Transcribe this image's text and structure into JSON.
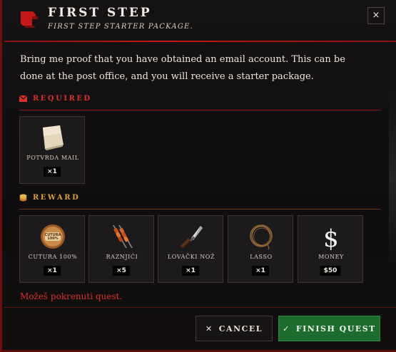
{
  "header": {
    "title": "FIRST STEP",
    "subtitle": "FIRST STEP STARTER PACKAGE.",
    "close_label": "×"
  },
  "description": "Bring me proof that you have obtained an email account. This can be done at the post office, and you will receive a starter package.",
  "required": {
    "heading": "REQUIRED",
    "items": [
      {
        "label": "POTVRDA MAIL",
        "qty": "×1",
        "icon": "paper-note-icon"
      }
    ]
  },
  "reward": {
    "heading": "REWARD",
    "items": [
      {
        "label": "CUTURA 100%",
        "qty": "×1",
        "icon": "burger-badge-icon"
      },
      {
        "label": "RAZNJIĆI",
        "qty": "×5",
        "icon": "skewers-icon"
      },
      {
        "label": "LOVAČKI NOŽ",
        "qty": "×1",
        "icon": "hunting-knife-icon"
      },
      {
        "label": "LASSO",
        "qty": "×1",
        "icon": "lasso-icon"
      },
      {
        "label": "MONEY",
        "qty": "$50",
        "icon": "dollar-icon"
      }
    ]
  },
  "status": "Možeš pokrenuti quest.",
  "buttons": {
    "cancel": "CANCEL",
    "finish": "FINISH QUEST"
  },
  "colors": {
    "accent_red": "#d8322a",
    "reward_gold": "#d9a040",
    "finish_green": "#1e6b30"
  }
}
